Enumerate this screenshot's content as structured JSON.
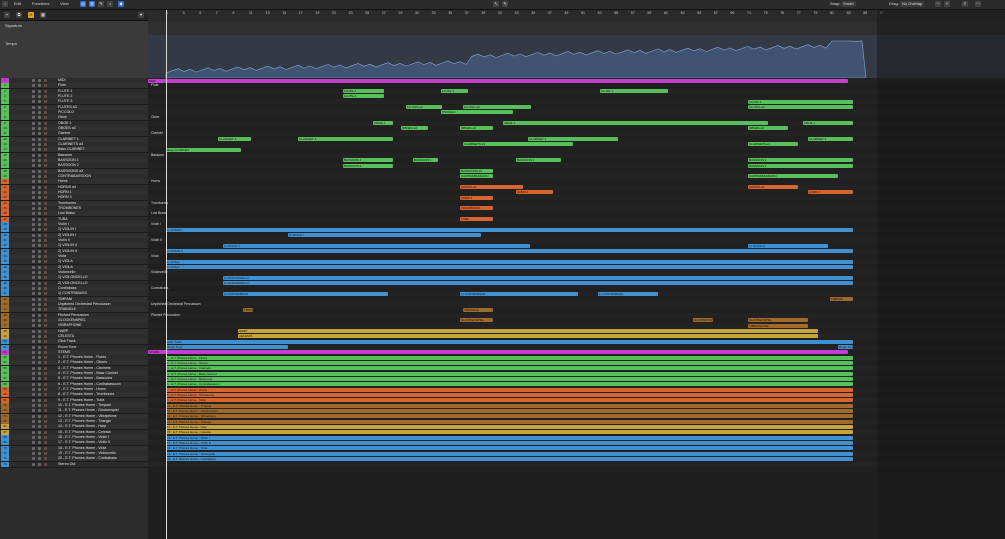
{
  "menubar": {
    "edit": "Edit",
    "functions": "Functions",
    "view": "View",
    "snap_label": "Snap:",
    "snap_value": "Smart",
    "drag_label": "Drag:",
    "drag_value": "No Overlap"
  },
  "left_header": {
    "signature": "Signature",
    "tempo": "Tempo"
  },
  "bars": [
    "1",
    "3",
    "5",
    "7",
    "9",
    "11",
    "13",
    "15",
    "17",
    "19",
    "21",
    "23",
    "25",
    "27",
    "29",
    "31",
    "33",
    "35",
    "37",
    "39",
    "41",
    "43",
    "45",
    "47",
    "49",
    "51",
    "53",
    "55",
    "57",
    "59",
    "61",
    "63",
    "65",
    "67",
    "69",
    "71",
    "73",
    "75",
    "77",
    "79",
    "81",
    "83",
    "85",
    "87"
  ],
  "colors": {
    "magenta": "#c43fcf",
    "green": "#58c05a",
    "teal": "#4cb79a",
    "orange": "#d76530",
    "blue": "#3f91d2",
    "brown": "#a26a2a",
    "gold": "#c7a33b",
    "red": "#c73c3c"
  },
  "tracks": [
    {
      "n": "1",
      "name": "MIDI",
      "c": "#c43fcf"
    },
    {
      "n": "2",
      "name": "Flute",
      "c": "#58c05a"
    },
    {
      "n": "3",
      "name": "FLUTE 1",
      "c": "#58c05a"
    },
    {
      "n": "4",
      "name": "FLUTE 2",
      "c": "#58c05a"
    },
    {
      "n": "5",
      "name": "FLUTE 3",
      "c": "#58c05a"
    },
    {
      "n": "6",
      "name": "FLUTES a3",
      "c": "#58c05a"
    },
    {
      "n": "7",
      "name": "PICCOLO",
      "c": "#58c05a"
    },
    {
      "n": "8",
      "name": "Oboe",
      "c": "#58c05a"
    },
    {
      "n": "9",
      "name": "OBOE 1",
      "c": "#58c05a"
    },
    {
      "n": "10",
      "name": "OBOES a3",
      "c": "#58c05a"
    },
    {
      "n": "11",
      "name": "Clarinet",
      "c": "#58c05a"
    },
    {
      "n": "12",
      "name": "CLARINET 1",
      "c": "#58c05a"
    },
    {
      "n": "13",
      "name": "CLARINETS a3",
      "c": "#58c05a"
    },
    {
      "n": "14",
      "name": "Bass CLARINET",
      "c": "#58c05a"
    },
    {
      "n": "15",
      "name": "Bassoon",
      "c": "#58c05a"
    },
    {
      "n": "16",
      "name": "BASSOON 1",
      "c": "#58c05a"
    },
    {
      "n": "17",
      "name": "BASSOON 2",
      "c": "#58c05a"
    },
    {
      "n": "18",
      "name": "BASSOONS a3",
      "c": "#58c05a"
    },
    {
      "n": "19",
      "name": "CONTRABASSOON",
      "c": "#58c05a"
    },
    {
      "n": "20",
      "name": "Horns",
      "c": "#d76530"
    },
    {
      "n": "21",
      "name": "HORNS a4",
      "c": "#d76530"
    },
    {
      "n": "22",
      "name": "HORN 1",
      "c": "#d76530"
    },
    {
      "n": "23",
      "name": "HORN 3",
      "c": "#d76530"
    },
    {
      "n": "24",
      "name": "Trombones",
      "c": "#d76530"
    },
    {
      "n": "25",
      "name": "TROMBONES",
      "c": "#d76530"
    },
    {
      "n": "26",
      "name": "Low Brass",
      "c": "#d76530"
    },
    {
      "n": "27",
      "name": "TUBA",
      "c": "#d76530"
    },
    {
      "n": "28",
      "name": "Violin I",
      "c": "#3f91d2"
    },
    {
      "n": "29",
      "name": "1) VIOLIN I",
      "c": "#3f91d2"
    },
    {
      "n": "30",
      "name": "2) VIOLIN I",
      "c": "#3f91d2"
    },
    {
      "n": "31",
      "name": "Violin II",
      "c": "#3f91d2"
    },
    {
      "n": "32",
      "name": "1) VIOLIN II",
      "c": "#3f91d2"
    },
    {
      "n": "33",
      "name": "2) VIOLIN II",
      "c": "#3f91d2"
    },
    {
      "n": "34",
      "name": "Viola",
      "c": "#3f91d2"
    },
    {
      "n": "35",
      "name": "1) VIOLA",
      "c": "#3f91d2"
    },
    {
      "n": "36",
      "name": "2) VIOLA",
      "c": "#3f91d2"
    },
    {
      "n": "37",
      "name": "Violoncello",
      "c": "#3f91d2"
    },
    {
      "n": "38",
      "name": "1) VIOLONCELLO",
      "c": "#3f91d2"
    },
    {
      "n": "39",
      "name": "2) VIOLONCELLO",
      "c": "#3f91d2"
    },
    {
      "n": "40",
      "name": "Contrabass",
      "c": "#3f91d2"
    },
    {
      "n": "41",
      "name": "1) CONTRABASS",
      "c": "#3f91d2"
    },
    {
      "n": "42",
      "name": "TIMPANI",
      "c": "#a26a2a"
    },
    {
      "n": "43",
      "name": "Unpitched Orchestral Percussion",
      "c": "#a26a2a"
    },
    {
      "n": "44",
      "name": "TRIANGLE",
      "c": "#a26a2a"
    },
    {
      "n": "45",
      "name": "Pitched Percussion",
      "c": "#a26a2a"
    },
    {
      "n": "46",
      "name": "GLOCKENSPIEL",
      "c": "#a26a2a"
    },
    {
      "n": "47",
      "name": "VIBRAPHONE",
      "c": "#a26a2a"
    },
    {
      "n": "48",
      "name": "HARP",
      "c": "#c7a33b"
    },
    {
      "n": "49",
      "name": "CELESTA",
      "c": "#c7a33b"
    },
    {
      "n": "50",
      "name": "Click Track",
      "c": "#3f91d2"
    },
    {
      "n": "51",
      "name": "Room Tone",
      "c": "#3f91d2"
    },
    {
      "n": "52",
      "name": "STEMS",
      "c": "#c43fcf"
    },
    {
      "n": "53",
      "name": "1 - E.T. Phones Home - Flutes",
      "c": "#58c05a"
    },
    {
      "n": "54",
      "name": "2 - E.T. Phones Home - Oboes",
      "c": "#58c05a"
    },
    {
      "n": "55",
      "name": "3 - E.T. Phones Home - Clarinets",
      "c": "#58c05a"
    },
    {
      "n": "56",
      "name": "4 - E.T. Phones Home - Bass Clarinet",
      "c": "#58c05a"
    },
    {
      "n": "57",
      "name": "5 - E.T. Phones Home - Bassoons",
      "c": "#58c05a"
    },
    {
      "n": "58",
      "name": "6 - E.T. Phones Home - Contrabassoon",
      "c": "#58c05a"
    },
    {
      "n": "59",
      "name": "7 - E.T. Phones Home - Horns",
      "c": "#d76530"
    },
    {
      "n": "60",
      "name": "8 - E.T. Phones Home - Trombones",
      "c": "#d76530"
    },
    {
      "n": "61",
      "name": "9 - E.T. Phones Home - Tuba",
      "c": "#d76530"
    },
    {
      "n": "62",
      "name": "10 - E.T. Phones Home - Timpani",
      "c": "#a26a2a"
    },
    {
      "n": "63",
      "name": "11 - E.T. Phones Home - Glockenspiel",
      "c": "#a26a2a"
    },
    {
      "n": "64",
      "name": "12 - E.T. Phones Home - Vibraphone",
      "c": "#a26a2a"
    },
    {
      "n": "65",
      "name": "13 - E.T. Phones Home - Triangle",
      "c": "#a26a2a"
    },
    {
      "n": "66",
      "name": "14 - E.T. Phones Home - Harp",
      "c": "#c7a33b"
    },
    {
      "n": "67",
      "name": "15 - E.T. Phones Home - Celesta",
      "c": "#c7a33b"
    },
    {
      "n": "68",
      "name": "16 - E.T. Phones Home - Violin I",
      "c": "#3f91d2"
    },
    {
      "n": "69",
      "name": "17 - E.T. Phones Home - Violin II",
      "c": "#3f91d2"
    },
    {
      "n": "70",
      "name": "18 - E.T. Phones Home - Viola",
      "c": "#3f91d2"
    },
    {
      "n": "71",
      "name": "19 - E.T. Phones Home - Violoncello",
      "c": "#3f91d2"
    },
    {
      "n": "72",
      "name": "20 - E.T. Phones Home - Contrabass",
      "c": "#3f91d2"
    },
    {
      "n": "73",
      "name": "Stereo Out",
      "c": "#3f91d2"
    }
  ],
  "folder_labels": [
    {
      "text": "Flute",
      "row": 1
    },
    {
      "text": "Oboe",
      "row": 7
    },
    {
      "text": "Clarinet",
      "row": 10
    },
    {
      "text": "Bassoon",
      "row": 14
    },
    {
      "text": "Horns",
      "row": 19
    },
    {
      "text": "Trombones",
      "row": 23
    },
    {
      "text": "Low Brass",
      "row": 25
    },
    {
      "text": "Violin I",
      "row": 27
    },
    {
      "text": "Violin II",
      "row": 30
    },
    {
      "text": "Viola",
      "row": 33
    },
    {
      "text": "Violoncello",
      "row": 36
    },
    {
      "text": "Contrabass",
      "row": 39
    },
    {
      "text": "Unpitched Orchestral Percussion",
      "row": 42
    },
    {
      "text": "Pitched Percussion",
      "row": 44
    }
  ],
  "regions": [
    {
      "row": 0,
      "s": 0,
      "e": 700,
      "t": "MIDI",
      "c": "#c43fcf"
    },
    {
      "row": 2,
      "s": 195,
      "e": 236,
      "t": "FLUTE 1",
      "c": "#58c05a"
    },
    {
      "row": 2,
      "s": 293,
      "e": 320,
      "t": "FLUTE 1",
      "c": "#58c05a"
    },
    {
      "row": 2,
      "s": 452,
      "e": 520,
      "t": "FLUTE 1",
      "c": "#58c05a"
    },
    {
      "row": 3,
      "s": 195,
      "e": 236,
      "t": "FLUTE 2",
      "c": "#58c05a"
    },
    {
      "row": 4,
      "s": 600,
      "e": 705,
      "t": "FLUTE 3",
      "c": "#58c05a"
    },
    {
      "row": 5,
      "s": 258,
      "e": 294,
      "t": "FLUTES a3",
      "c": "#58c05a"
    },
    {
      "row": 5,
      "s": 315,
      "e": 383,
      "t": "FLUTES a3",
      "c": "#58c05a"
    },
    {
      "row": 5,
      "s": 600,
      "e": 705,
      "t": "FLUTES a3",
      "c": "#58c05a"
    },
    {
      "row": 6,
      "s": 293,
      "e": 365,
      "t": "PICCOLO",
      "c": "#58c05a"
    },
    {
      "row": 8,
      "s": 225,
      "e": 245,
      "t": "OBOE 1",
      "c": "#58c05a"
    },
    {
      "row": 8,
      "s": 355,
      "e": 620,
      "t": "OBOE 1",
      "c": "#58c05a"
    },
    {
      "row": 8,
      "s": 655,
      "e": 705,
      "t": "OBOE 1",
      "c": "#58c05a"
    },
    {
      "row": 9,
      "s": 253,
      "e": 280,
      "t": "OBOES a3",
      "c": "#58c05a"
    },
    {
      "row": 9,
      "s": 312,
      "e": 345,
      "t": "OBOES a3",
      "c": "#58c05a"
    },
    {
      "row": 9,
      "s": 600,
      "e": 640,
      "t": "OBOES a3",
      "c": "#58c05a"
    },
    {
      "row": 11,
      "s": 70,
      "e": 103,
      "t": "CLARINET 1",
      "c": "#58c05a"
    },
    {
      "row": 11,
      "s": 150,
      "e": 245,
      "t": "CLARINET 1",
      "c": "#58c05a"
    },
    {
      "row": 11,
      "s": 380,
      "e": 470,
      "t": "CLARINET 1",
      "c": "#58c05a"
    },
    {
      "row": 11,
      "s": 660,
      "e": 705,
      "t": "CLARINET 1",
      "c": "#58c05a"
    },
    {
      "row": 12,
      "s": 315,
      "e": 425,
      "t": "CLARINETS a3",
      "c": "#58c05a"
    },
    {
      "row": 12,
      "s": 600,
      "e": 650,
      "t": "CLARINETS a3",
      "c": "#58c05a"
    },
    {
      "row": 13,
      "s": 18,
      "e": 93,
      "t": "Bass CLARINET",
      "c": "#58c05a"
    },
    {
      "row": 15,
      "s": 195,
      "e": 245,
      "t": "BASSOON 1",
      "c": "#58c05a"
    },
    {
      "row": 15,
      "s": 265,
      "e": 290,
      "t": "BASSOON 1",
      "c": "#58c05a"
    },
    {
      "row": 15,
      "s": 368,
      "e": 413,
      "t": "BASSOON 1",
      "c": "#58c05a"
    },
    {
      "row": 15,
      "s": 600,
      "e": 705,
      "t": "BASSOON 1",
      "c": "#58c05a"
    },
    {
      "row": 16,
      "s": 195,
      "e": 245,
      "t": "BASSOON 2",
      "c": "#58c05a"
    },
    {
      "row": 16,
      "s": 600,
      "e": 705,
      "t": "BASSOON 2",
      "c": "#58c05a"
    },
    {
      "row": 17,
      "s": 312,
      "e": 345,
      "t": "BASSOONS a3",
      "c": "#58c05a"
    },
    {
      "row": 18,
      "s": 312,
      "e": 345,
      "t": "CONTRABASSOON",
      "c": "#58c05a"
    },
    {
      "row": 18,
      "s": 600,
      "e": 690,
      "t": "CONTRABASSOON",
      "c": "#58c05a"
    },
    {
      "row": 20,
      "s": 312,
      "e": 375,
      "t": "HORNS a4",
      "c": "#d76530"
    },
    {
      "row": 20,
      "s": 600,
      "e": 650,
      "t": "HORNS a4",
      "c": "#d76530"
    },
    {
      "row": 21,
      "s": 368,
      "e": 405,
      "t": "HORN 1",
      "c": "#d76530"
    },
    {
      "row": 21,
      "s": 660,
      "e": 705,
      "t": "HORN 1",
      "c": "#d76530"
    },
    {
      "row": 22,
      "s": 312,
      "e": 345,
      "t": "HORN 3",
      "c": "#d76530"
    },
    {
      "row": 24,
      "s": 312,
      "e": 345,
      "t": "TROMBONES",
      "c": "#d76530"
    },
    {
      "row": 26,
      "s": 312,
      "e": 345,
      "t": "TUBA",
      "c": "#d76530"
    },
    {
      "row": 28,
      "s": 18,
      "e": 705,
      "t": "1) VIOLIN I",
      "c": "#3f91d2"
    },
    {
      "row": 29,
      "s": 140,
      "e": 333,
      "t": "2) VIOLIN I",
      "c": "#3f91d2"
    },
    {
      "row": 31,
      "s": 75,
      "e": 382,
      "t": "1) VIOLIN II",
      "c": "#3f91d2"
    },
    {
      "row": 31,
      "s": 600,
      "e": 680,
      "t": "1) VIOLIN II",
      "c": "#3f91d2"
    },
    {
      "row": 32,
      "s": 18,
      "e": 705,
      "t": "2) VIOLIN II",
      "c": "#3f91d2"
    },
    {
      "row": 34,
      "s": 18,
      "e": 705,
      "t": "1) VIOLA",
      "c": "#3f91d2"
    },
    {
      "row": 35,
      "s": 18,
      "e": 705,
      "t": "2) VIOLA",
      "c": "#3f91d2"
    },
    {
      "row": 37,
      "s": 75,
      "e": 705,
      "t": "1) VIOLONCELLO",
      "c": "#3f91d2"
    },
    {
      "row": 38,
      "s": 75,
      "e": 705,
      "t": "2) VIOLONCELLO",
      "c": "#3f91d2"
    },
    {
      "row": 40,
      "s": 75,
      "e": 240,
      "t": "1) CONTRABASS",
      "c": "#3f91d2"
    },
    {
      "row": 40,
      "s": 312,
      "e": 430,
      "t": "1) CONTRABASS",
      "c": "#3f91d2"
    },
    {
      "row": 40,
      "s": 450,
      "e": 510,
      "t": "1) CONTRABASS",
      "c": "#3f91d2"
    },
    {
      "row": 41,
      "s": 682,
      "e": 705,
      "t": "TIMPANI",
      "c": "#a26a2a"
    },
    {
      "row": 43,
      "s": 95,
      "e": 105,
      "t": "TRIANGLE",
      "c": "#a26a2a"
    },
    {
      "row": 43,
      "s": 315,
      "e": 345,
      "t": "TRIANGLE",
      "c": "#a26a2a"
    },
    {
      "row": 45,
      "s": 312,
      "e": 345,
      "t": "GLOCKENSPIEL",
      "c": "#a26a2a"
    },
    {
      "row": 45,
      "s": 545,
      "e": 565,
      "t": "GLOCKENSPIEL",
      "c": "#a26a2a"
    },
    {
      "row": 45,
      "s": 600,
      "e": 660,
      "t": "GLOCKENSPIEL",
      "c": "#a26a2a"
    },
    {
      "row": 46,
      "s": 600,
      "e": 660,
      "t": "VIBRAPHONE",
      "c": "#a26a2a"
    },
    {
      "row": 47,
      "s": 90,
      "e": 670,
      "t": "HARP",
      "c": "#c7a33b"
    },
    {
      "row": 48,
      "s": 90,
      "e": 670,
      "t": "CELESTA",
      "c": "#c7a33b"
    },
    {
      "row": 49,
      "s": 18,
      "e": 705,
      "t": "Click Track",
      "c": "#3f91d2"
    },
    {
      "row": 50,
      "s": 18,
      "e": 140,
      "t": "Room Tone",
      "c": "#3f91d2"
    },
    {
      "row": 50,
      "s": 690,
      "e": 705,
      "t": "Room Tone",
      "c": "#3f91d2"
    },
    {
      "row": 51,
      "s": 0,
      "e": 700,
      "t": "STEMS",
      "c": "#c43fcf"
    }
  ],
  "stems_from_row": 52,
  "stems_to_row": 71
}
